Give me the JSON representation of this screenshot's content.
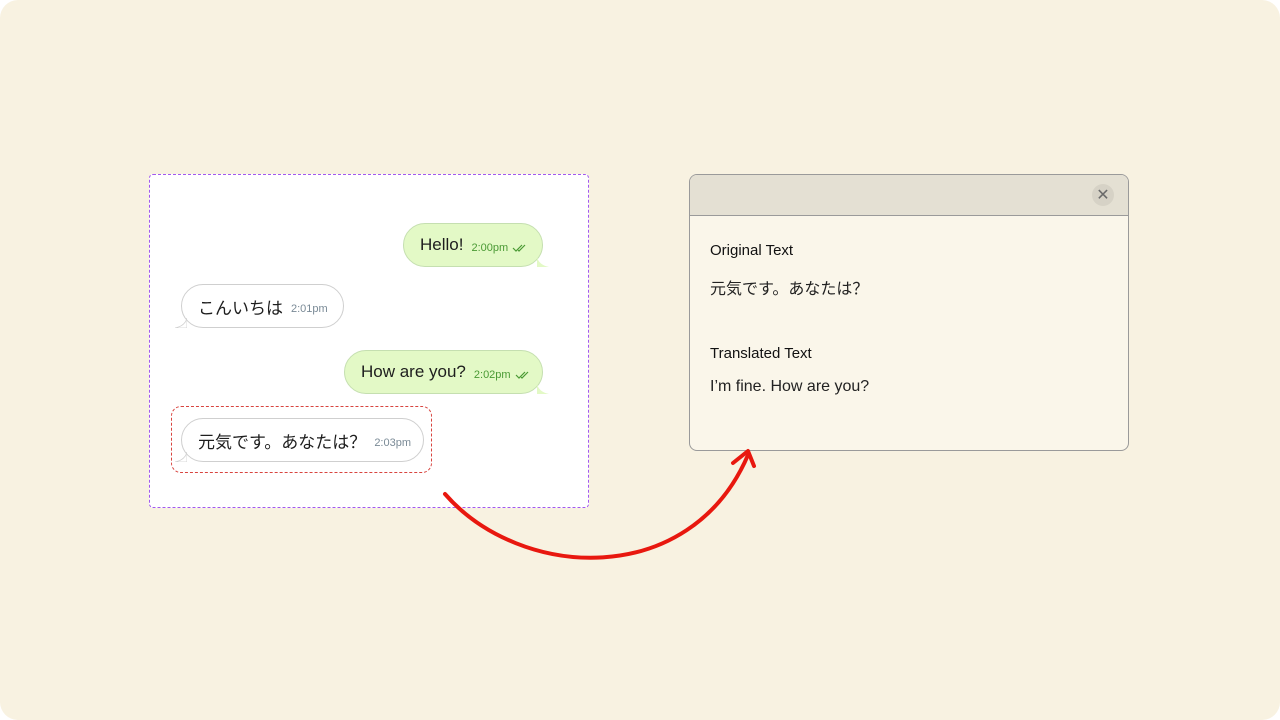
{
  "chat": {
    "messages": [
      {
        "direction": "outgoing",
        "text": "Hello!",
        "time": "2:00pm",
        "read": true
      },
      {
        "direction": "incoming",
        "text": "こんいちは",
        "time": "2:01pm"
      },
      {
        "direction": "outgoing",
        "text": "How are you?",
        "time": "2:02pm",
        "read": true
      },
      {
        "direction": "incoming",
        "text": "元気です。あなたは？",
        "time": "2:03pm",
        "selected": true
      }
    ]
  },
  "translation_window": {
    "original_label": "Original Text",
    "original_value": "元気です。あなたは？",
    "translated_label": "Translated Text",
    "translated_value": "I’m fine. How are you?",
    "close_icon": "close-icon"
  },
  "colors": {
    "background": "#f8f2e1",
    "outgoing_bubble": "#e3f9c6",
    "selection_border": "#d8443f",
    "panel_border": "#a259f0",
    "arrow": "#e8180f"
  }
}
